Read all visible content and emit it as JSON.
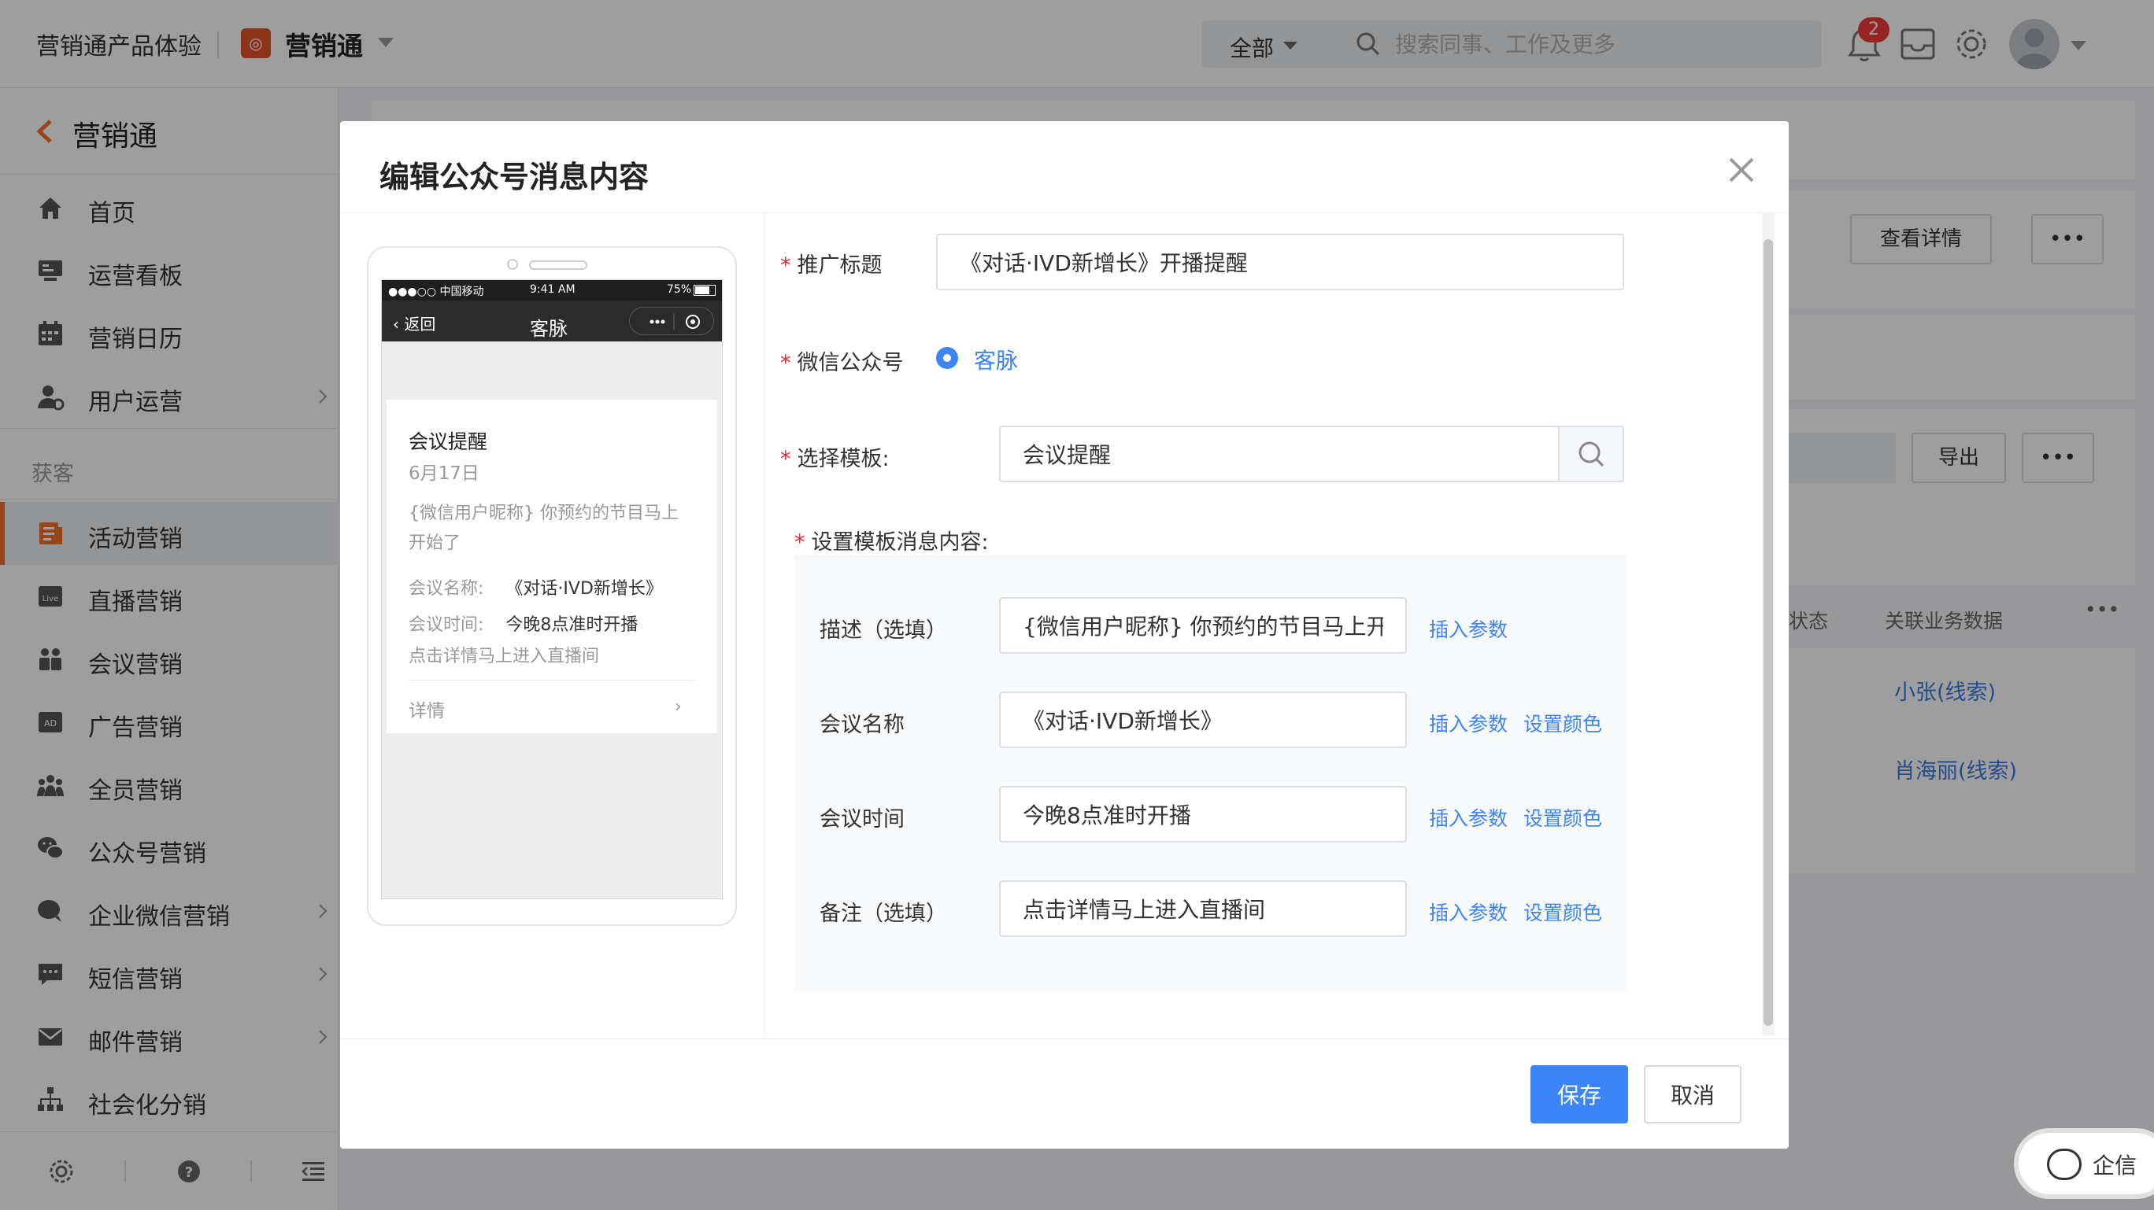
{
  "topbar": {
    "org_name": "营销通产品体验",
    "app_name": "营销通",
    "search_scope": "全部",
    "search_placeholder": "搜索同事、工作及更多",
    "notification_count": "2"
  },
  "sidebar": {
    "title": "营销通",
    "items_top": [
      {
        "label": "首页",
        "icon": "home-icon"
      },
      {
        "label": "运营看板",
        "icon": "dashboard-icon"
      },
      {
        "label": "营销日历",
        "icon": "calendar-icon"
      },
      {
        "label": "用户运营",
        "icon": "user-ops-icon"
      }
    ],
    "group_label": "获客",
    "items_group": [
      {
        "label": "活动营销",
        "icon": "activity-icon",
        "active": true
      },
      {
        "label": "直播营销",
        "icon": "live-icon"
      },
      {
        "label": "会议营销",
        "icon": "meeting-icon"
      },
      {
        "label": "广告营销",
        "icon": "ad-icon"
      },
      {
        "label": "全员营销",
        "icon": "team-icon"
      },
      {
        "label": "公众号营销",
        "icon": "wechat-icon"
      },
      {
        "label": "企业微信营销",
        "icon": "wecom-icon"
      },
      {
        "label": "短信营销",
        "icon": "sms-icon"
      },
      {
        "label": "邮件营销",
        "icon": "mail-icon"
      },
      {
        "label": "社会化分销",
        "icon": "distribution-icon"
      }
    ]
  },
  "background": {
    "view_details": "查看详情",
    "more": "•••",
    "export": "导出",
    "col_status": "状态",
    "col_related": "关联业务数据",
    "row1_link": "小张(线索)",
    "row2_link": "肖海丽(线索)",
    "chat_label": "企信"
  },
  "modal": {
    "title": "编辑公众号消息内容",
    "save": "保存",
    "cancel": "取消",
    "form": {
      "promo_title_label": "推广标题",
      "promo_title_value": "《对话·IVD新增长》开播提醒",
      "account_label": "微信公众号",
      "account_value": "客脉",
      "template_label": "选择模板:",
      "template_value": "会议提醒",
      "content_label": "设置模板消息内容:",
      "insert_param": "插入参数",
      "set_color": "设置颜色",
      "fields": [
        {
          "label": "描述（选填）",
          "value": "{微信用户昵称} 你预约的节目马上开"
        },
        {
          "label": "会议名称",
          "value": "《对话·IVD新增长》"
        },
        {
          "label": "会议时间",
          "value": "今晚8点准时开播"
        },
        {
          "label": "备注（选填）",
          "value": "点击详情马上进入直播间"
        }
      ]
    },
    "preview": {
      "carrier": "●●●○○ 中国移动",
      "time": "9:41 AM",
      "battery": "75%",
      "back": "返回",
      "nav_title": "客脉",
      "card_title": "会议提醒",
      "card_date": "6月17日",
      "card_desc": "{微信用户昵称} 你预约的节目马上开始了",
      "name_label": "会议名称:",
      "name_value": "《对话·IVD新增长》",
      "time_label": "会议时间:",
      "time_value": "今晚8点准时开播",
      "note": "点击详情马上进入直播间",
      "detail": "详情"
    }
  },
  "colors": {
    "accent": "#3b85f6",
    "brand_orange": "#f27227",
    "required": "#f5222d"
  }
}
